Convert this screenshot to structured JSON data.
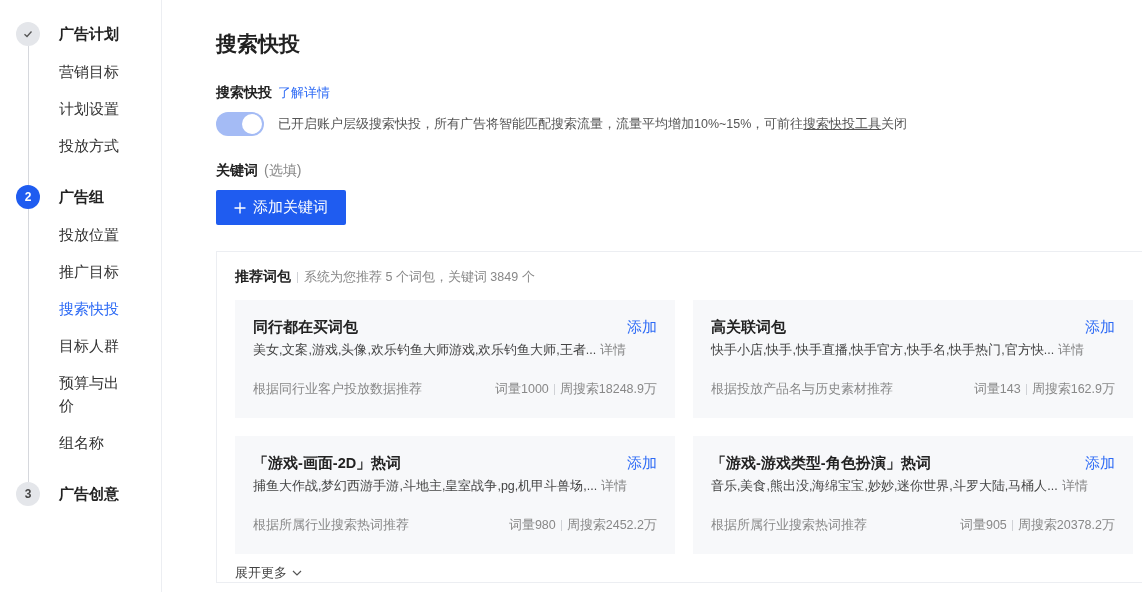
{
  "sidebar": {
    "steps": [
      {
        "kind": "done",
        "title": "广告计划",
        "items": [
          {
            "label": "营销目标",
            "selected": false
          },
          {
            "label": "计划设置",
            "selected": false
          },
          {
            "label": "投放方式",
            "selected": false
          }
        ]
      },
      {
        "kind": "current",
        "number": "2",
        "title": "广告组",
        "items": [
          {
            "label": "投放位置",
            "selected": false
          },
          {
            "label": "推广目标",
            "selected": false
          },
          {
            "label": "搜索快投",
            "selected": true
          },
          {
            "label": "目标人群",
            "selected": false
          },
          {
            "label": "预算与出价",
            "selected": false
          },
          {
            "label": "组名称",
            "selected": false
          }
        ]
      },
      {
        "kind": "pending",
        "number": "3",
        "title": "广告创意"
      }
    ]
  },
  "page_title": "搜索快投",
  "quick_search": {
    "label": "搜索快投",
    "link": "了解详情",
    "toggle": {
      "on": true,
      "disabled": true
    },
    "note_before": "已开启账户层级搜索快投，所有广告将智能匹配搜索流量，流量平均增加10%~15%，可前往",
    "note_link": "搜索快投工具",
    "note_after": "关闭"
  },
  "keywords": {
    "label": "关键词",
    "hint": "(选填)",
    "add_button": "添加关键词"
  },
  "recommend": {
    "title": "推荐词包",
    "summary": "系统为您推荐 5 个词包，关键词 3849 个",
    "cards": [
      {
        "title": "同行都在买词包",
        "action": "添加",
        "words": "美女,文案,游戏,头像,欢乐钓鱼大师游戏,欢乐钓鱼大师,王者...",
        "detail": "详情",
        "source": "根据同行业客户投放数据推荐",
        "count": "词量1000",
        "weekly": "周搜索18248.9万"
      },
      {
        "title": "高关联词包",
        "action": "添加",
        "words": "快手小店,快手,快手直播,快手官方,快手名,快手热门,官方快...",
        "detail": "详情",
        "source": "根据投放产品名与历史素材推荐",
        "count": "词量143",
        "weekly": "周搜索162.9万"
      },
      {
        "title": "「游戏-画面-2D」热词",
        "action": "添加",
        "words": "捕鱼大作战,梦幻西游手游,斗地主,皇室战争,pg,机甲斗兽场,...",
        "detail": "详情",
        "source": "根据所属行业搜索热词推荐",
        "count": "词量980",
        "weekly": "周搜索2452.2万"
      },
      {
        "title": "「游戏-游戏类型-角色扮演」热词",
        "action": "添加",
        "words": "音乐,美食,熊出没,海绵宝宝,妙妙,迷你世界,斗罗大陆,马桶人...",
        "detail": "详情",
        "source": "根据所属行业搜索热词推荐",
        "count": "词量905",
        "weekly": "周搜索20378.2万"
      }
    ],
    "more": "展开更多"
  }
}
